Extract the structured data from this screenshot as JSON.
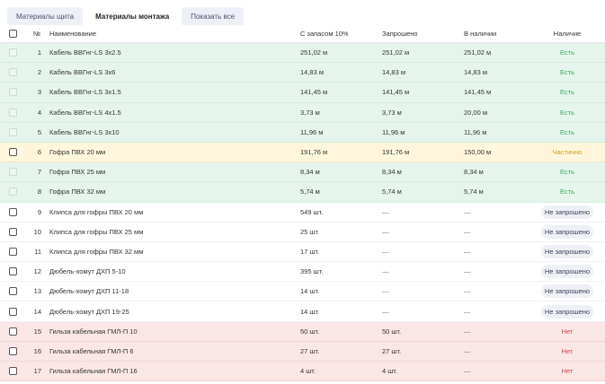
{
  "tabs": [
    {
      "label": "Материалы щита",
      "active": false
    },
    {
      "label": "Материалы монтажа",
      "active": true
    },
    {
      "label": "Показать все",
      "active": false
    }
  ],
  "columns": {
    "num": "№",
    "name": "Наименование",
    "reserve": "С запасом 10%",
    "requested": "Запрошено",
    "in_stock": "В наличии",
    "availability": "Наличие"
  },
  "rows": [
    {
      "num": "1",
      "name": "Кабель ВВГнг-LS 3х2.5",
      "reserve": "251,02 м",
      "requested": "251,02 м",
      "in_stock": "251,02 м",
      "status": "Есть",
      "kind": "green"
    },
    {
      "num": "2",
      "name": "Кабель ВВГнг-LS 3х6",
      "reserve": "14,83 м",
      "requested": "14,83 м",
      "in_stock": "14,83 м",
      "status": "Есть",
      "kind": "green"
    },
    {
      "num": "3",
      "name": "Кабель ВВГнг-LS 3х1.5",
      "reserve": "141,45 м",
      "requested": "141,45 м",
      "in_stock": "141,45 м",
      "status": "Есть",
      "kind": "green"
    },
    {
      "num": "4",
      "name": "Кабель ВВГнг-LS 4х1.5",
      "reserve": "3,73 м",
      "requested": "3,73 м",
      "in_stock": "20,00 м",
      "status": "Есть",
      "kind": "green"
    },
    {
      "num": "5",
      "name": "Кабель ВВГнг-LS 3х10",
      "reserve": "11,96 м",
      "requested": "11,96 м",
      "in_stock": "11,96 м",
      "status": "Есть",
      "kind": "green"
    },
    {
      "num": "6",
      "name": "Гофра ПВХ 20 мм",
      "reserve": "191,76 м",
      "requested": "191,76 м",
      "in_stock": "150,00 м",
      "status": "Частично",
      "kind": "yellow"
    },
    {
      "num": "7",
      "name": "Гофра ПВХ 25 мм",
      "reserve": "8,34 м",
      "requested": "8,34 м",
      "in_stock": "8,34 м",
      "status": "Есть",
      "kind": "green"
    },
    {
      "num": "8",
      "name": "Гофра ПВХ 32 мм",
      "reserve": "5,74 м",
      "requested": "5,74 м",
      "in_stock": "5,74 м",
      "status": "Есть",
      "kind": "green"
    },
    {
      "num": "9",
      "name": "Клипса для гофры ПВХ 20 мм",
      "reserve": "549 шт.",
      "requested": "—",
      "in_stock": "—",
      "status": "Не запрошено",
      "kind": "white"
    },
    {
      "num": "10",
      "name": "Клипса для гофры ПВХ 25 мм",
      "reserve": "25 шт.",
      "requested": "—",
      "in_stock": "—",
      "status": "Не запрошено",
      "kind": "white"
    },
    {
      "num": "11",
      "name": "Клипса для гофры ПВХ 32 мм",
      "reserve": "17 шт.",
      "requested": "—",
      "in_stock": "—",
      "status": "Не запрошено",
      "kind": "white"
    },
    {
      "num": "12",
      "name": "Дюбель-хомут ДХП 5-10",
      "reserve": "395 шт.",
      "requested": "—",
      "in_stock": "—",
      "status": "Не запрошено",
      "kind": "white"
    },
    {
      "num": "13",
      "name": "Дюбель-хомут ДХП 11-18",
      "reserve": "14 шт.",
      "requested": "—",
      "in_stock": "—",
      "status": "Не запрошено",
      "kind": "white"
    },
    {
      "num": "14",
      "name": "Дюбель-хомут ДХП 19-25",
      "reserve": "14 шт.",
      "requested": "—",
      "in_stock": "—",
      "status": "Не запрошено",
      "kind": "white"
    },
    {
      "num": "15",
      "name": "Гильза кабельная ГМЛ-П 10",
      "reserve": "50 шт.",
      "requested": "50 шт.",
      "in_stock": "—",
      "status": "Нет",
      "kind": "red"
    },
    {
      "num": "16",
      "name": "Гильза кабельная ГМЛ-П 6",
      "reserve": "27 шт.",
      "requested": "27 шт.",
      "in_stock": "—",
      "status": "Нет",
      "kind": "red"
    },
    {
      "num": "17",
      "name": "Гильза кабельная ГМЛ-П 16",
      "reserve": "4 шт.",
      "requested": "4 шт.",
      "in_stock": "—",
      "status": "Нет",
      "kind": "red"
    }
  ],
  "colors": {
    "row_green": "#e6f5ec",
    "row_yellow": "#fff6dc",
    "row_red": "#fbe6e6",
    "status_ok": "#38a85a",
    "status_partial": "#d09a1a",
    "status_no": "#d04545"
  }
}
